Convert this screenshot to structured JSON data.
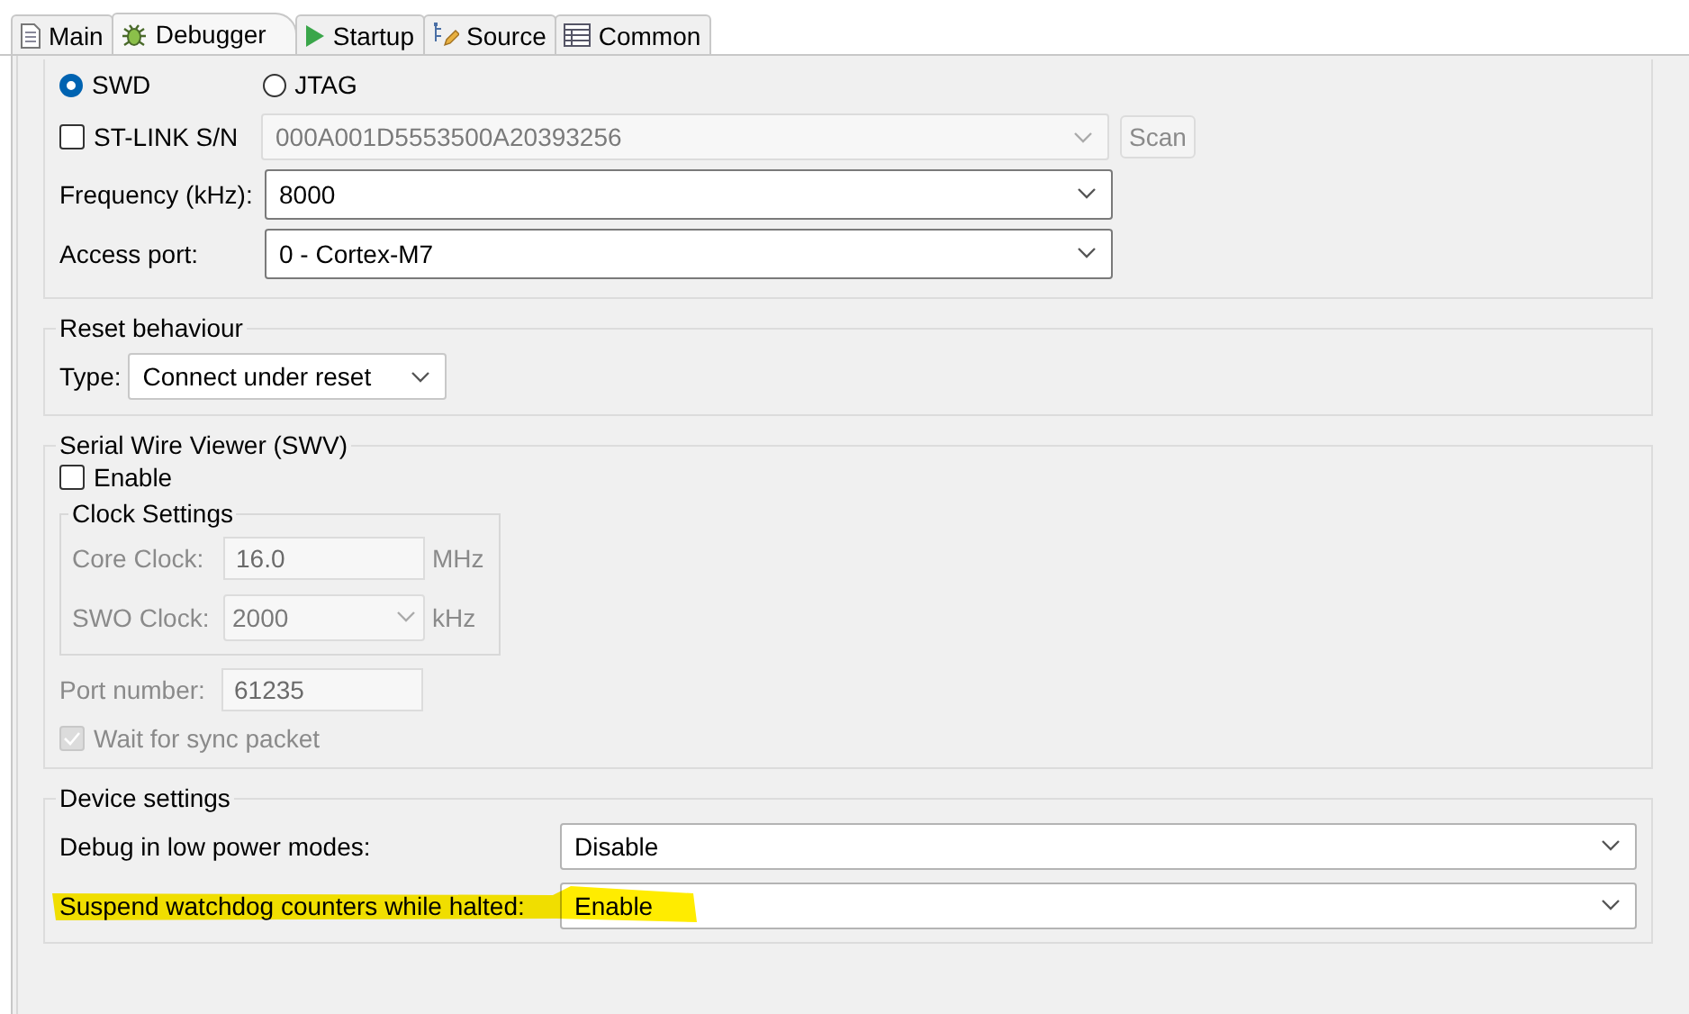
{
  "tabs": [
    {
      "label": "Main",
      "selected": false
    },
    {
      "label": "Debugger",
      "selected": true
    },
    {
      "label": "Startup",
      "selected": false
    },
    {
      "label": "Source",
      "selected": false
    },
    {
      "label": "Common",
      "selected": false
    }
  ],
  "interface": {
    "options": [
      {
        "label": "SWD",
        "selected": true
      },
      {
        "label": "JTAG",
        "selected": false
      }
    ],
    "stlink": {
      "label": "ST-LINK S/N",
      "checked": false,
      "value": "000A001D5553500A20393256",
      "disabled": true,
      "button": "Scan"
    },
    "fields": [
      {
        "label": "Frequency (kHz):",
        "value": "8000"
      },
      {
        "label": "Access port:",
        "value": "0 - Cortex-M7"
      }
    ]
  },
  "reset": {
    "title": "Reset behaviour",
    "type_label": "Type:",
    "value": "Connect under reset"
  },
  "swv": {
    "title": "Serial Wire Viewer (SWV)",
    "enable": {
      "label": "Enable",
      "checked": false
    },
    "disabled": true,
    "clock": {
      "title": "Clock Settings",
      "core": {
        "label": "Core Clock:",
        "value": "16.0",
        "unit": "MHz"
      },
      "swo": {
        "label": "SWO Clock:",
        "value": "2000",
        "unit": "kHz"
      }
    },
    "port": {
      "label": "Port number:",
      "value": "61235"
    },
    "wait": {
      "label": "Wait for sync packet",
      "checked": true
    }
  },
  "device": {
    "title": "Device settings",
    "rows": [
      {
        "label": "Debug in low power modes:",
        "value": "Disable",
        "highlighted": false
      },
      {
        "label": "Suspend watchdog counters while halted:",
        "value": "Enable",
        "highlighted": true
      }
    ]
  }
}
